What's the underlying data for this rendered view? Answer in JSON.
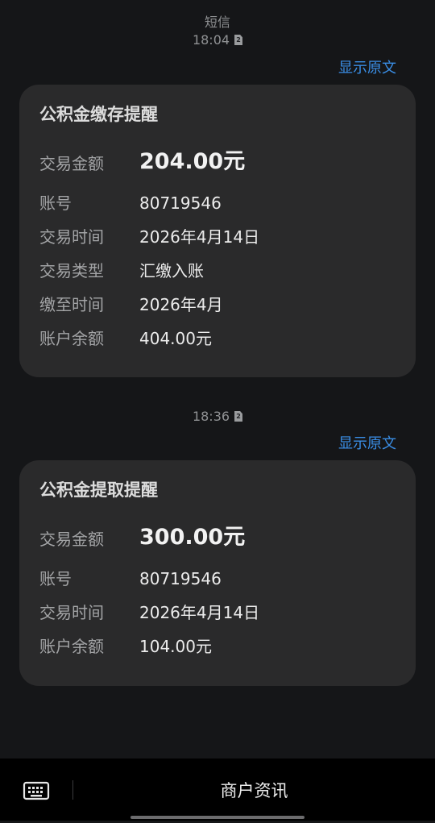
{
  "header": {
    "sim_label": "短信",
    "sim_number": "2",
    "first_time": "18:04"
  },
  "messages": [
    {
      "show_original": "显示原文",
      "title": "公积金缴存提醒",
      "rows": [
        {
          "label": "交易金额",
          "value": "204.00元"
        },
        {
          "label": "账号",
          "value": "80719546"
        },
        {
          "label": "交易时间",
          "value": "2026年4月14日"
        },
        {
          "label": "交易类型",
          "value": "汇缴入账"
        },
        {
          "label": "缴至时间",
          "value": "2026年4月"
        },
        {
          "label": "账户余额",
          "value": "404.00元"
        }
      ]
    },
    {
      "time": "18:36",
      "show_original": "显示原文",
      "title": "公积金提取提醒",
      "rows": [
        {
          "label": "交易金额",
          "value": "300.00元"
        },
        {
          "label": "账号",
          "value": "80719546"
        },
        {
          "label": "交易时间",
          "value": "2026年4月14日"
        },
        {
          "label": "账户余额",
          "value": "104.00元"
        }
      ]
    }
  ],
  "bottom_bar": {
    "keyboard_icon": "keyboard-icon",
    "menu_label": "商户资讯"
  },
  "colors": {
    "background": "#151618",
    "card": "#2a2a2b",
    "link": "#3a8ee6",
    "bar": "#000000"
  }
}
